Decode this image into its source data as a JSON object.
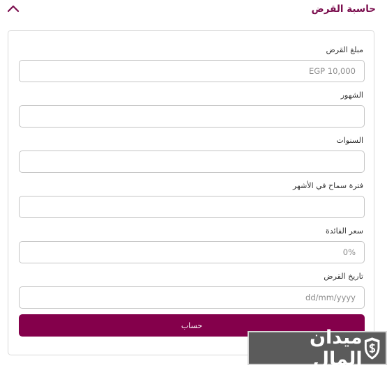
{
  "header": {
    "title": "حاسبة القرض",
    "toggle_icon": "chevron-up-icon"
  },
  "form": {
    "loan_amount": {
      "label": "مبلغ القرض",
      "placeholder": "EGP 10,000",
      "value": ""
    },
    "months": {
      "label": "الشهور",
      "placeholder": "",
      "value": ""
    },
    "years": {
      "label": "السنوات",
      "placeholder": "",
      "value": ""
    },
    "grace_period": {
      "label": "فترة سماح في الأشهر",
      "placeholder": "",
      "value": ""
    },
    "interest_rate": {
      "label": "سعر الفائدة",
      "placeholder": "0%",
      "value": ""
    },
    "loan_date": {
      "label": "تاريخ القرض",
      "placeholder": "dd/mm/yyyy",
      "value": ""
    },
    "calculate_label": "حساب"
  },
  "watermark": {
    "text": "ميدان المال",
    "icon": "shield-dollar-icon"
  },
  "colors": {
    "accent": "#84004b",
    "title": "#7b0e4e",
    "border": "#c4c4c4"
  }
}
